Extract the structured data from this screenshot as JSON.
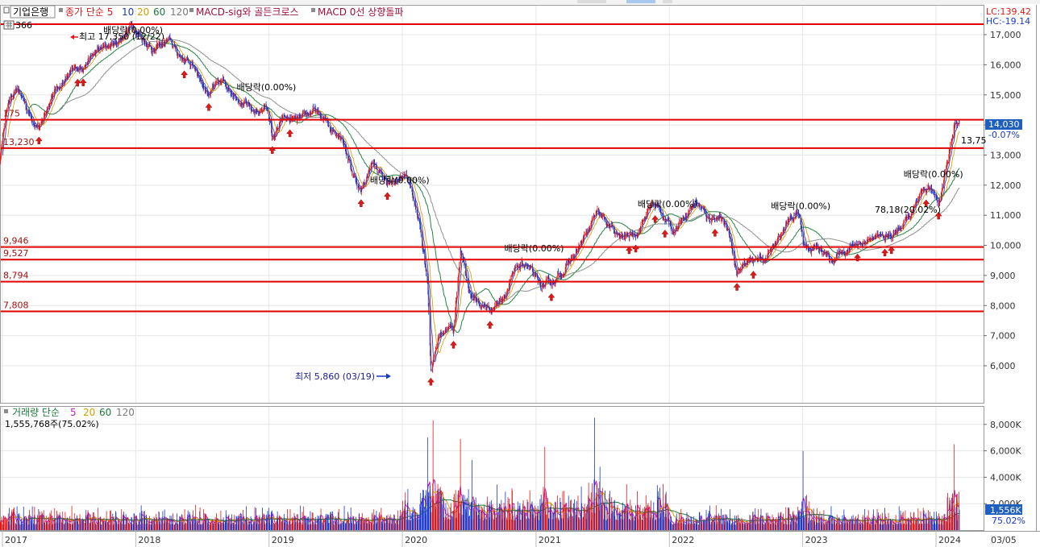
{
  "header": {
    "stock_name": "기업은행",
    "items": [
      {
        "text": "종가 단순 5",
        "color": "#d02020"
      },
      {
        "text": "10",
        "color": "#1f3fb0"
      },
      {
        "text": "20",
        "color": "#d4a000"
      },
      {
        "text": "60",
        "color": "#1a7a3a"
      },
      {
        "text": "120",
        "color": "#7a7a7a"
      },
      {
        "text": "MACD-sig와 골든크로스",
        "color": "#a0103a"
      },
      {
        "text": "MACD 0선 상향돌파",
        "color": "#a0103a"
      }
    ],
    "sub_label": "366",
    "lc": "LC:139.42",
    "hc": "HC:-19.14"
  },
  "price_panel": {
    "y_ticks": [
      "17,000",
      "16,000",
      "15,000",
      "14,000",
      "13,000",
      "12,000",
      "11,000",
      "10,000",
      "9,000",
      "8,000",
      "7,000",
      "6,000"
    ],
    "current_price": "14,030",
    "change_pct": "-0.07%",
    "last_price_label": "13,75",
    "max_label": "최고 17,350 (12/22)",
    "min_label": "최저 5,860 (03/19)",
    "h_lines": [
      {
        "value": 17350,
        "label": ""
      },
      {
        "value": 14175,
        "label": "175"
      },
      {
        "value": 13230,
        "label": "13,230"
      },
      {
        "value": 9946,
        "label": "9,946"
      },
      {
        "value": 9527,
        "label": "9,527"
      },
      {
        "value": 8794,
        "label": "8,794"
      },
      {
        "value": 7808,
        "label": "7,808"
      }
    ],
    "dividend_notes": [
      {
        "date": "2017-12-27",
        "value": 17050,
        "text": "배당락(0.00%)"
      },
      {
        "date": "2018-12-27",
        "value": 15150,
        "text": "배당락(0.00%)"
      },
      {
        "date": "2019-12-27",
        "value": 12060,
        "text": "배당락(0.00%)"
      },
      {
        "date": "2020-12-29",
        "value": 9800,
        "text": "배당락(0.00%)"
      },
      {
        "date": "2021-12-29",
        "value": 11270,
        "text": "배당락(0.00%)"
      },
      {
        "date": "2022-12-29",
        "value": 11200,
        "text": "배당락(0.00%)"
      },
      {
        "date": "2023-12-27",
        "value": 12270,
        "text": "배당락(0.00%)"
      }
    ],
    "annotation": "78,18(20.02%)"
  },
  "volume_panel": {
    "title": "거래량 단순",
    "ma_items": [
      {
        "text": "5",
        "color": "#c020c0"
      },
      {
        "text": "20",
        "color": "#d4a000"
      },
      {
        "text": "60",
        "color": "#1a7a3a"
      },
      {
        "text": "120",
        "color": "#7a7a7a"
      }
    ],
    "info": "1,555,768주(75.02%)",
    "y_ticks": [
      "8,000K",
      "6,000K",
      "4,000K",
      "2,000K"
    ],
    "current_volume": "1,556K",
    "current_pct": "75.02%"
  },
  "x_labels": [
    "2017",
    "2018",
    "2019",
    "2020",
    "2021",
    "2022",
    "2023",
    "2024",
    "03/05"
  ],
  "colors": {
    "candle_up": "#e01818",
    "candle_down": "#1838d0",
    "hline": "#e00000",
    "grid": "#e6e6e6",
    "ma5": "#d02020",
    "ma10": "#1f3fb0",
    "ma20": "#d4a000",
    "ma60": "#1a7a3a",
    "ma120": "#8a8a8a",
    "current_box": "#1f5fc0"
  },
  "chart_data": {
    "type": "candlestick",
    "title": "기업은행",
    "x_range": [
      "2016-12",
      "2024-03-05"
    ],
    "price_ylim": [
      5500,
      17700
    ],
    "volume_ylim": [
      0,
      9000000
    ],
    "price_path": [
      [
        "2016-12-20",
        12500
      ],
      [
        "2017-01-15",
        14800
      ],
      [
        "2017-02-15",
        15100
      ],
      [
        "2017-03-15",
        14400
      ],
      [
        "2017-04-15",
        13900
      ],
      [
        "2017-05-15",
        15000
      ],
      [
        "2017-06-20",
        15500
      ],
      [
        "2017-07-20",
        15800
      ],
      [
        "2017-09-15",
        16400
      ],
      [
        "2017-11-15",
        16800
      ],
      [
        "2017-12-22",
        17350
      ],
      [
        "2018-01-20",
        16900
      ],
      [
        "2018-02-20",
        16500
      ],
      [
        "2018-04-01",
        16800
      ],
      [
        "2018-05-01",
        16300
      ],
      [
        "2018-06-15",
        15900
      ],
      [
        "2018-07-15",
        15100
      ],
      [
        "2018-09-01",
        15400
      ],
      [
        "2018-10-15",
        14900
      ],
      [
        "2018-11-15",
        14400
      ],
      [
        "2018-12-27",
        14600
      ],
      [
        "2019-01-10",
        13500
      ],
      [
        "2019-02-10",
        14200
      ],
      [
        "2019-04-01",
        14100
      ],
      [
        "2019-05-01",
        14500
      ],
      [
        "2019-06-20",
        13900
      ],
      [
        "2019-07-20",
        13700
      ],
      [
        "2019-08-15",
        12500
      ],
      [
        "2019-09-10",
        11800
      ],
      [
        "2019-10-10",
        12800
      ],
      [
        "2019-11-10",
        12200
      ],
      [
        "2019-12-10",
        12000
      ],
      [
        "2020-01-10",
        12400
      ],
      [
        "2020-02-01",
        11500
      ],
      [
        "2020-02-20",
        10500
      ],
      [
        "2020-03-10",
        8800
      ],
      [
        "2020-03-19",
        5860
      ],
      [
        "2020-04-10",
        7000
      ],
      [
        "2020-05-01",
        7300
      ],
      [
        "2020-05-20",
        7200
      ],
      [
        "2020-06-08",
        9900
      ],
      [
        "2020-07-01",
        8500
      ],
      [
        "2020-08-01",
        8000
      ],
      [
        "2020-09-01",
        7900
      ],
      [
        "2020-10-01",
        8300
      ],
      [
        "2020-11-10",
        9200
      ],
      [
        "2020-12-05",
        9400
      ],
      [
        "2021-01-10",
        8600
      ],
      [
        "2021-02-10",
        8700
      ],
      [
        "2021-03-10",
        9100
      ],
      [
        "2021-04-20",
        9700
      ],
      [
        "2021-05-20",
        10400
      ],
      [
        "2021-06-15",
        11000
      ],
      [
        "2021-07-15",
        10700
      ],
      [
        "2021-08-20",
        10200
      ],
      [
        "2021-10-01",
        10400
      ],
      [
        "2021-11-15",
        11400
      ],
      [
        "2021-12-10",
        11100
      ],
      [
        "2022-01-10",
        10500
      ],
      [
        "2022-02-10",
        11000
      ],
      [
        "2022-03-15",
        11500
      ],
      [
        "2022-04-15",
        10900
      ],
      [
        "2022-05-15",
        11000
      ],
      [
        "2022-06-15",
        10400
      ],
      [
        "2022-07-05",
        9000
      ],
      [
        "2022-08-15",
        9600
      ],
      [
        "2022-09-15",
        9500
      ],
      [
        "2022-10-20",
        10000
      ],
      [
        "2022-11-20",
        10800
      ],
      [
        "2022-12-20",
        11100
      ],
      [
        "2023-01-05",
        10000
      ],
      [
        "2023-02-10",
        9900
      ],
      [
        "2023-03-20",
        9500
      ],
      [
        "2023-04-20",
        9800
      ],
      [
        "2023-06-01",
        10100
      ],
      [
        "2023-07-15",
        10200
      ],
      [
        "2023-09-01",
        10300
      ],
      [
        "2023-10-10",
        10800
      ],
      [
        "2023-11-10",
        11300
      ],
      [
        "2023-12-10",
        11900
      ],
      [
        "2024-01-10",
        11500
      ],
      [
        "2024-02-01",
        12800
      ],
      [
        "2024-02-20",
        14100
      ],
      [
        "2024-03-05",
        14030
      ]
    ],
    "volume_spikes": [
      [
        "2020-03-10",
        7000000
      ],
      [
        "2020-03-25",
        8300000
      ],
      [
        "2020-06-08",
        6900000
      ],
      [
        "2020-07-10",
        5300000
      ],
      [
        "2021-01-25",
        6300000
      ],
      [
        "2021-06-10",
        8500000
      ],
      [
        "2021-06-25",
        4800000
      ],
      [
        "2023-01-02",
        6000000
      ],
      [
        "2024-02-20",
        6500000
      ],
      [
        "2024-03-05",
        1555768
      ]
    ]
  }
}
